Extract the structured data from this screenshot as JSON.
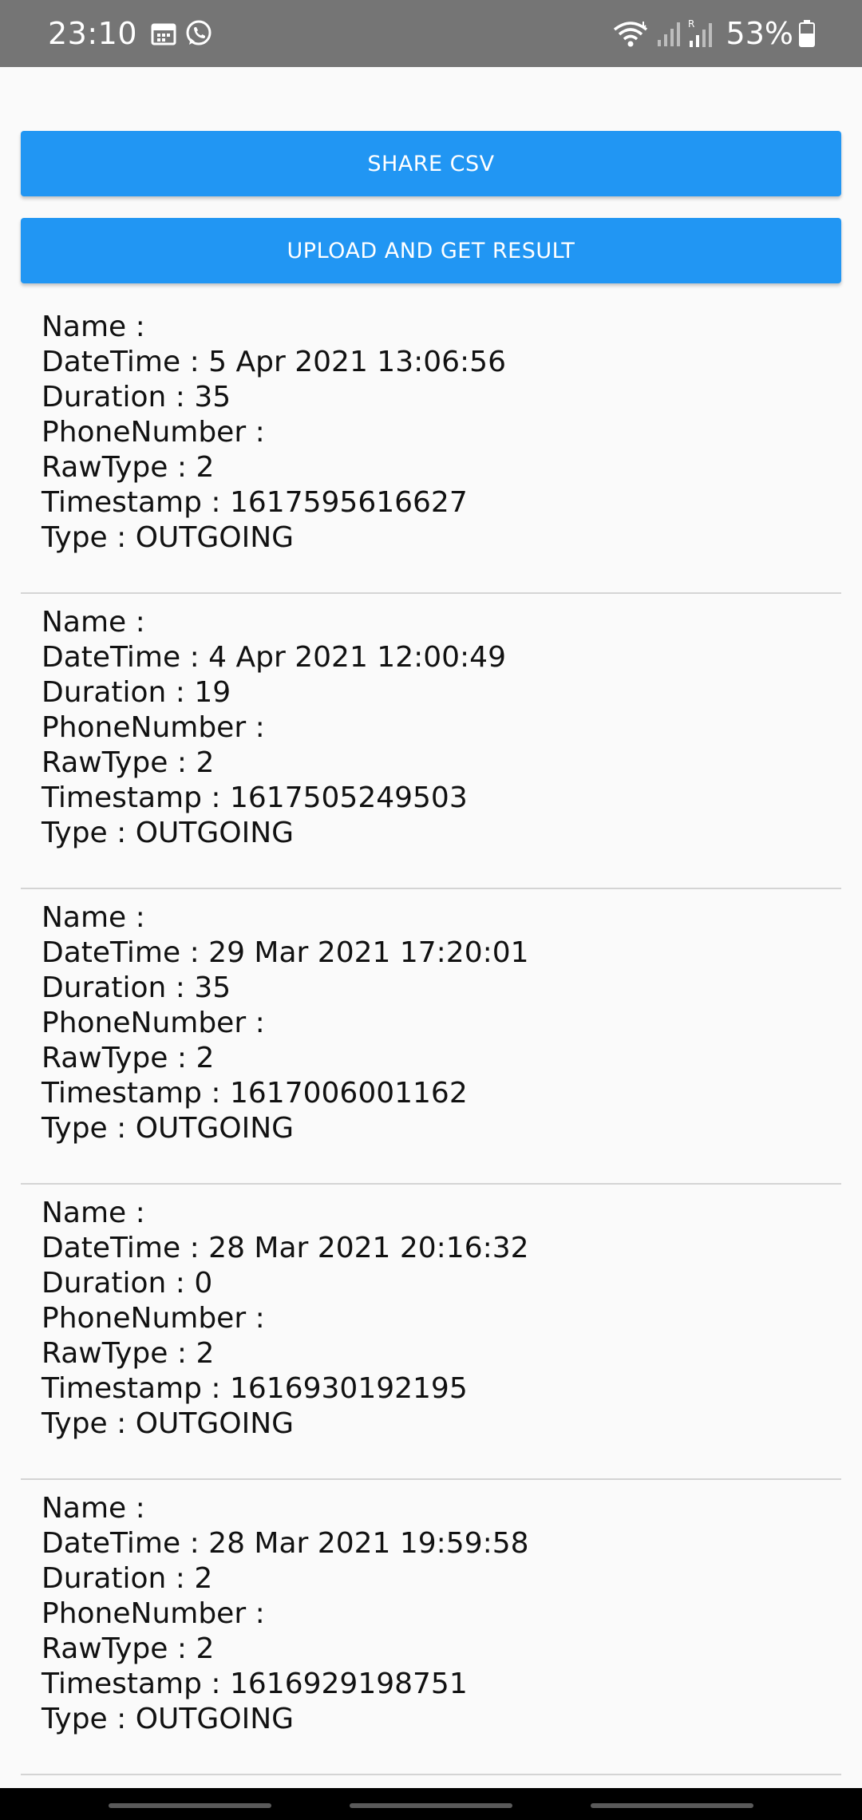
{
  "status_bar": {
    "time": "23:10",
    "battery_percent": "53%",
    "icons_left": [
      "calendar-icon",
      "whatsapp-icon"
    ],
    "icons_right": [
      "wifi-icon",
      "signal-icon",
      "roaming-signal-icon",
      "battery-icon"
    ],
    "roaming_label": "R"
  },
  "actions": {
    "share_label": "SHARE CSV",
    "upload_label": "UPLOAD AND GET RESULT"
  },
  "labels": {
    "name": "Name :",
    "datetime": "DateTime :",
    "duration": "Duration :",
    "phone": "PhoneNumber :",
    "rawtype": "RawType :",
    "timestamp": "Timestamp :",
    "type": "Type :"
  },
  "calls": [
    {
      "name": "",
      "datetime": "5 Apr 2021 13:06:56",
      "duration": "35",
      "phone": "",
      "rawtype": "2",
      "timestamp": "1617595616627",
      "type": "OUTGOING"
    },
    {
      "name": "",
      "datetime": "4 Apr 2021 12:00:49",
      "duration": "19",
      "phone": "",
      "rawtype": "2",
      "timestamp": "1617505249503",
      "type": "OUTGOING"
    },
    {
      "name": "",
      "datetime": "29 Mar 2021 17:20:01",
      "duration": "35",
      "phone": "",
      "rawtype": "2",
      "timestamp": "1617006001162",
      "type": "OUTGOING"
    },
    {
      "name": "",
      "datetime": "28 Mar 2021 20:16:32",
      "duration": "0",
      "phone": "",
      "rawtype": "2",
      "timestamp": "1616930192195",
      "type": "OUTGOING"
    },
    {
      "name": "",
      "datetime": "28 Mar 2021 19:59:58",
      "duration": "2",
      "phone": "",
      "rawtype": "2",
      "timestamp": "1616929198751",
      "type": "OUTGOING"
    }
  ],
  "colors": {
    "status_bar": "#757575",
    "button": "#2196f3",
    "background": "#fafafa",
    "divider": "#d4d4d4"
  }
}
